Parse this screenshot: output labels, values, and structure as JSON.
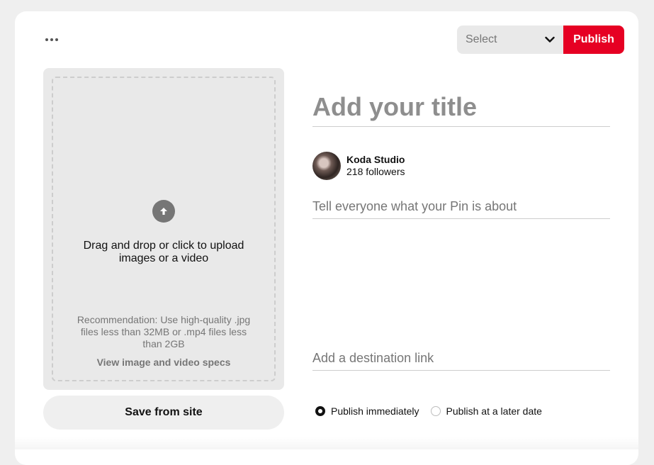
{
  "toolbar": {
    "more_icon": "ellipsis-icon",
    "select_value": "Select",
    "publish_label": "Publish",
    "publish_color": "#e60023"
  },
  "upload": {
    "icon": "arrow-up-circle-icon",
    "drag_text": "Drag and drop or click to upload images or a video",
    "recommendation": "Recommendation: Use high-quality .jpg files less than 32MB or .mp4 files less than 2GB",
    "specs_link": "View image and video specs",
    "save_from_site_label": "Save from site"
  },
  "form": {
    "title_placeholder": "Add your title",
    "profile": {
      "name": "Koda Studio",
      "followers": "218 followers"
    },
    "description_placeholder": "Tell everyone what your Pin is about",
    "link_placeholder": "Add a destination link"
  },
  "publish_options": {
    "immediately_label": "Publish immediately",
    "later_label": "Publish at a later date",
    "selected": "immediately"
  }
}
